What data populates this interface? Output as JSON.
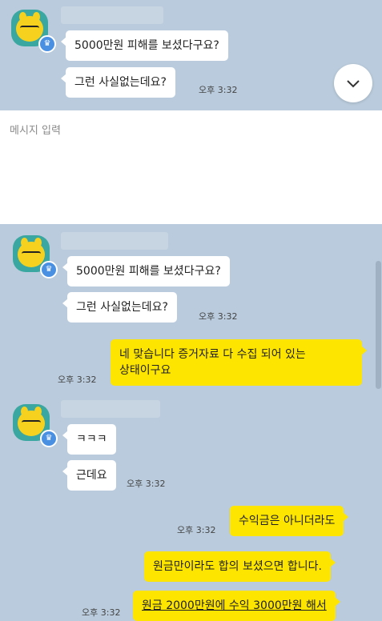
{
  "top_chat": {
    "msg1": "5000만원 피해를 보셨다구요?",
    "msg2": "그런 사실없는데요?",
    "time": "오후 3:32"
  },
  "input": {
    "placeholder": "메시지 입력"
  },
  "chat": {
    "messages": [
      {
        "text": "5000만원 피해를 보셨다구요?",
        "side": "left"
      },
      {
        "text": "그런 사실없는데요?",
        "side": "left",
        "time": "오후 3:32"
      },
      {
        "text_line1": "네 맞습니다 증거자료 다 수집 되어 있는",
        "text_line2": "상태이구요",
        "side": "right",
        "time": "오후 3:32"
      },
      {
        "text": "ㅋㅋㅋ",
        "side": "left"
      },
      {
        "text": "근데요",
        "side": "left",
        "time": "오후 3:32"
      },
      {
        "text": "수익금은 아니더라도",
        "side": "right",
        "time": "오후 3:32"
      },
      {
        "text": "원금만이라도 합의 보셨으면 합니다.",
        "side": "right"
      },
      {
        "text": "원금 2000만원에 수익 3000만원 해서",
        "side": "right",
        "time": "오후 3:32"
      }
    ]
  },
  "colors": {
    "chat_bg": "#b9cbdc",
    "my_bubble": "#fee500",
    "their_bubble": "#ffffff"
  },
  "icons": {
    "scroll": "chevron-down-icon",
    "badge": "crown-icon"
  }
}
